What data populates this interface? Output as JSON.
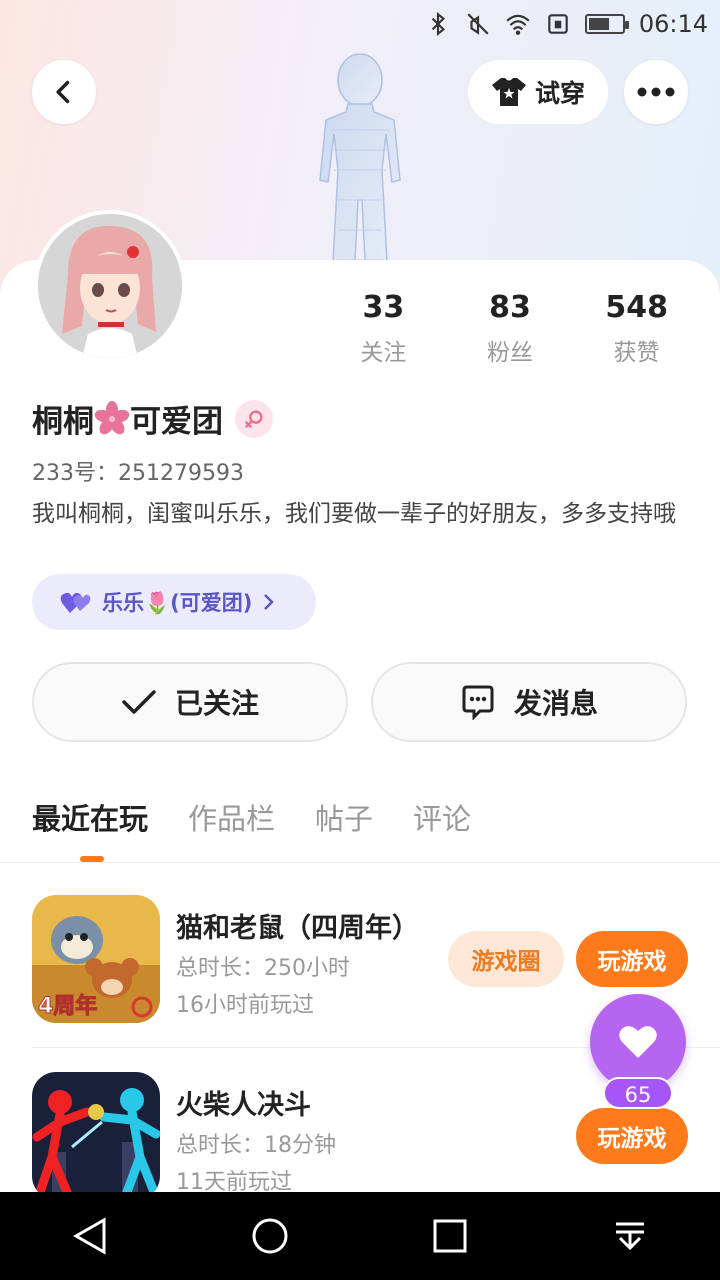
{
  "status_bar": {
    "time": "06:14"
  },
  "header": {
    "try_on_label": "试穿"
  },
  "profile": {
    "nickname_part1": "桐桐",
    "nickname_part2": "可爱团",
    "uid": "233号：251279593",
    "bio": "我叫桐桐，闺蜜叫乐乐，我们要做一辈子的好朋友，多多支持哦",
    "friend_tag": "乐乐🌷(可爱团)"
  },
  "stats": [
    {
      "value": "33",
      "label": "关注"
    },
    {
      "value": "83",
      "label": "粉丝"
    },
    {
      "value": "548",
      "label": "获赞"
    }
  ],
  "actions": {
    "follow_label": "已关注",
    "message_label": "发消息"
  },
  "tabs": [
    "最近在玩",
    "作品栏",
    "帖子",
    "评论"
  ],
  "games": [
    {
      "name": "猫和老鼠（四周年）",
      "duration": "总时长：250小时",
      "last_played": "16小时前玩过",
      "circle_label": "游戏圈",
      "play_label": "玩游戏",
      "icon": "tom-and-jerry-icon"
    },
    {
      "name": "火柴人决斗",
      "duration": "总时长：18分钟",
      "last_played": "11天前玩过",
      "play_label": "玩游戏",
      "icon": "stickman-duel-icon"
    }
  ],
  "fab": {
    "count": "65",
    "icon": "heart-icon"
  },
  "colors": {
    "accent": "#ff7a1a",
    "purple": "#b565f0",
    "tag_text": "#5a56c8"
  }
}
